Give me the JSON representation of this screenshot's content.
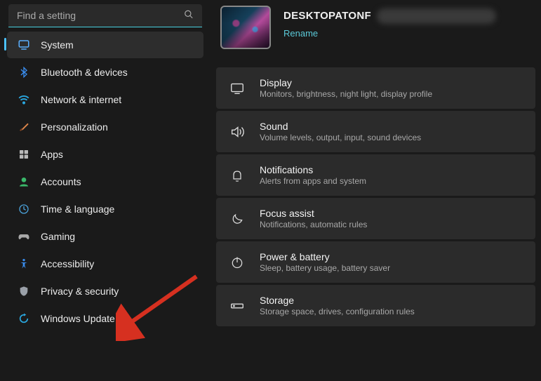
{
  "search": {
    "placeholder": "Find a setting"
  },
  "sidebar": {
    "items": [
      {
        "label": "System"
      },
      {
        "label": "Bluetooth & devices"
      },
      {
        "label": "Network & internet"
      },
      {
        "label": "Personalization"
      },
      {
        "label": "Apps"
      },
      {
        "label": "Accounts"
      },
      {
        "label": "Time & language"
      },
      {
        "label": "Gaming"
      },
      {
        "label": "Accessibility"
      },
      {
        "label": "Privacy & security"
      },
      {
        "label": "Windows Update"
      }
    ]
  },
  "header": {
    "device_name": "DESKTOPATONF",
    "rename_label": "Rename"
  },
  "tiles": [
    {
      "title": "Display",
      "subtitle": "Monitors, brightness, night light, display profile"
    },
    {
      "title": "Sound",
      "subtitle": "Volume levels, output, input, sound devices"
    },
    {
      "title": "Notifications",
      "subtitle": "Alerts from apps and system"
    },
    {
      "title": "Focus assist",
      "subtitle": "Notifications, automatic rules"
    },
    {
      "title": "Power & battery",
      "subtitle": "Sleep, battery usage, battery saver"
    },
    {
      "title": "Storage",
      "subtitle": "Storage space, drives, configuration rules"
    }
  ]
}
